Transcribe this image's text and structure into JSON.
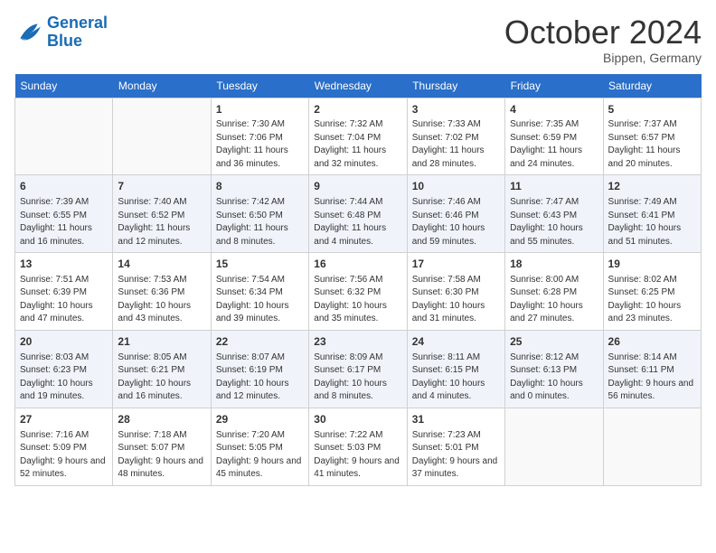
{
  "header": {
    "logo_line1": "General",
    "logo_line2": "Blue",
    "month": "October 2024",
    "location": "Bippen, Germany"
  },
  "weekdays": [
    "Sunday",
    "Monday",
    "Tuesday",
    "Wednesday",
    "Thursday",
    "Friday",
    "Saturday"
  ],
  "weeks": [
    [
      {
        "day": "",
        "detail": ""
      },
      {
        "day": "",
        "detail": ""
      },
      {
        "day": "1",
        "detail": "Sunrise: 7:30 AM\nSunset: 7:06 PM\nDaylight: 11 hours and 36 minutes."
      },
      {
        "day": "2",
        "detail": "Sunrise: 7:32 AM\nSunset: 7:04 PM\nDaylight: 11 hours and 32 minutes."
      },
      {
        "day": "3",
        "detail": "Sunrise: 7:33 AM\nSunset: 7:02 PM\nDaylight: 11 hours and 28 minutes."
      },
      {
        "day": "4",
        "detail": "Sunrise: 7:35 AM\nSunset: 6:59 PM\nDaylight: 11 hours and 24 minutes."
      },
      {
        "day": "5",
        "detail": "Sunrise: 7:37 AM\nSunset: 6:57 PM\nDaylight: 11 hours and 20 minutes."
      }
    ],
    [
      {
        "day": "6",
        "detail": "Sunrise: 7:39 AM\nSunset: 6:55 PM\nDaylight: 11 hours and 16 minutes."
      },
      {
        "day": "7",
        "detail": "Sunrise: 7:40 AM\nSunset: 6:52 PM\nDaylight: 11 hours and 12 minutes."
      },
      {
        "day": "8",
        "detail": "Sunrise: 7:42 AM\nSunset: 6:50 PM\nDaylight: 11 hours and 8 minutes."
      },
      {
        "day": "9",
        "detail": "Sunrise: 7:44 AM\nSunset: 6:48 PM\nDaylight: 11 hours and 4 minutes."
      },
      {
        "day": "10",
        "detail": "Sunrise: 7:46 AM\nSunset: 6:46 PM\nDaylight: 10 hours and 59 minutes."
      },
      {
        "day": "11",
        "detail": "Sunrise: 7:47 AM\nSunset: 6:43 PM\nDaylight: 10 hours and 55 minutes."
      },
      {
        "day": "12",
        "detail": "Sunrise: 7:49 AM\nSunset: 6:41 PM\nDaylight: 10 hours and 51 minutes."
      }
    ],
    [
      {
        "day": "13",
        "detail": "Sunrise: 7:51 AM\nSunset: 6:39 PM\nDaylight: 10 hours and 47 minutes."
      },
      {
        "day": "14",
        "detail": "Sunrise: 7:53 AM\nSunset: 6:36 PM\nDaylight: 10 hours and 43 minutes."
      },
      {
        "day": "15",
        "detail": "Sunrise: 7:54 AM\nSunset: 6:34 PM\nDaylight: 10 hours and 39 minutes."
      },
      {
        "day": "16",
        "detail": "Sunrise: 7:56 AM\nSunset: 6:32 PM\nDaylight: 10 hours and 35 minutes."
      },
      {
        "day": "17",
        "detail": "Sunrise: 7:58 AM\nSunset: 6:30 PM\nDaylight: 10 hours and 31 minutes."
      },
      {
        "day": "18",
        "detail": "Sunrise: 8:00 AM\nSunset: 6:28 PM\nDaylight: 10 hours and 27 minutes."
      },
      {
        "day": "19",
        "detail": "Sunrise: 8:02 AM\nSunset: 6:25 PM\nDaylight: 10 hours and 23 minutes."
      }
    ],
    [
      {
        "day": "20",
        "detail": "Sunrise: 8:03 AM\nSunset: 6:23 PM\nDaylight: 10 hours and 19 minutes."
      },
      {
        "day": "21",
        "detail": "Sunrise: 8:05 AM\nSunset: 6:21 PM\nDaylight: 10 hours and 16 minutes."
      },
      {
        "day": "22",
        "detail": "Sunrise: 8:07 AM\nSunset: 6:19 PM\nDaylight: 10 hours and 12 minutes."
      },
      {
        "day": "23",
        "detail": "Sunrise: 8:09 AM\nSunset: 6:17 PM\nDaylight: 10 hours and 8 minutes."
      },
      {
        "day": "24",
        "detail": "Sunrise: 8:11 AM\nSunset: 6:15 PM\nDaylight: 10 hours and 4 minutes."
      },
      {
        "day": "25",
        "detail": "Sunrise: 8:12 AM\nSunset: 6:13 PM\nDaylight: 10 hours and 0 minutes."
      },
      {
        "day": "26",
        "detail": "Sunrise: 8:14 AM\nSunset: 6:11 PM\nDaylight: 9 hours and 56 minutes."
      }
    ],
    [
      {
        "day": "27",
        "detail": "Sunrise: 7:16 AM\nSunset: 5:09 PM\nDaylight: 9 hours and 52 minutes."
      },
      {
        "day": "28",
        "detail": "Sunrise: 7:18 AM\nSunset: 5:07 PM\nDaylight: 9 hours and 48 minutes."
      },
      {
        "day": "29",
        "detail": "Sunrise: 7:20 AM\nSunset: 5:05 PM\nDaylight: 9 hours and 45 minutes."
      },
      {
        "day": "30",
        "detail": "Sunrise: 7:22 AM\nSunset: 5:03 PM\nDaylight: 9 hours and 41 minutes."
      },
      {
        "day": "31",
        "detail": "Sunrise: 7:23 AM\nSunset: 5:01 PM\nDaylight: 9 hours and 37 minutes."
      },
      {
        "day": "",
        "detail": ""
      },
      {
        "day": "",
        "detail": ""
      }
    ]
  ]
}
